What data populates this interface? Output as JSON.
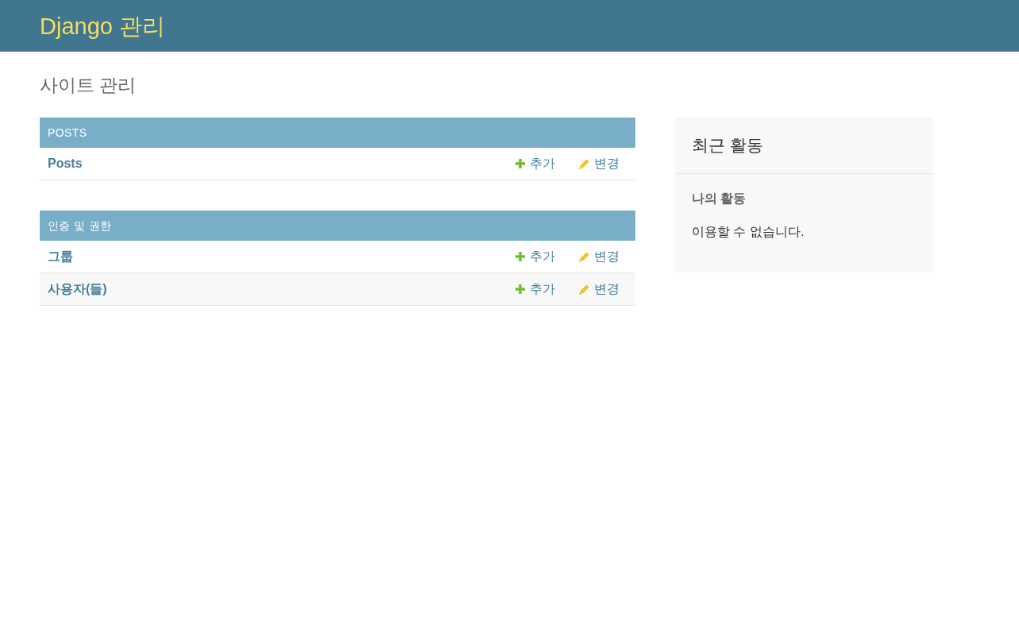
{
  "header": {
    "title": "Django 관리"
  },
  "page_title": "사이트 관리",
  "modules": [
    {
      "caption": "POSTS",
      "rows": [
        {
          "name": "Posts",
          "add": "추가",
          "change": "변경"
        }
      ]
    },
    {
      "caption": "인증 및 권한",
      "rows": [
        {
          "name": "그룹",
          "add": "추가",
          "change": "변경"
        },
        {
          "name": "사용자(들)",
          "add": "추가",
          "change": "변경"
        }
      ]
    }
  ],
  "recent_actions": {
    "title": "최근 활동",
    "subtitle": "나의 활동",
    "message": "이용할 수 없습니다."
  }
}
